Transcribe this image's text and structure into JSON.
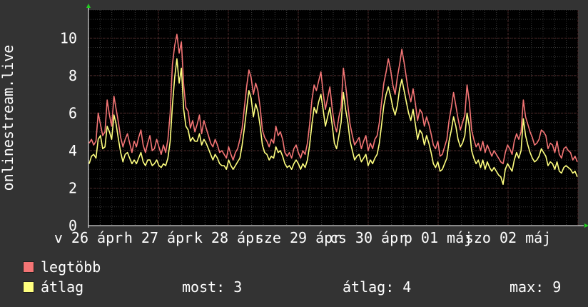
{
  "chart_data": {
    "type": "line",
    "ylabel": "onlinestream.live",
    "ylim": [
      0,
      11.5
    ],
    "yticks": [
      0,
      2,
      4,
      6,
      8,
      10
    ],
    "x_tick_labels": [
      "v 26 ápr",
      "h 27 ápr",
      "k 28 ápr",
      "sze 29 ápr",
      "cs 30 ápr",
      "p 01 máj",
      "szo 02 máj"
    ],
    "grid": true,
    "colors": {
      "background": "#333333",
      "plot_bg": "#000000",
      "legtobb": "#f47575",
      "atlag": "#ffff7f",
      "axis": "#ffffff",
      "grid_major": "#5a2a2a",
      "grid_minor": "#3a3a3a",
      "arrow": "#22cc22"
    },
    "series": [
      {
        "name": "legtöbb",
        "color": "#f47575",
        "values": [
          4.4,
          4.6,
          4.3,
          4.5,
          6.0,
          5.4,
          4.8,
          5.0,
          6.7,
          5.9,
          5.3,
          6.9,
          6.2,
          5.5,
          4.7,
          4.2,
          4.6,
          4.9,
          4.4,
          3.9,
          4.5,
          4.2,
          4.7,
          5.1,
          4.3,
          3.9,
          4.4,
          4.8,
          4.0,
          4.1,
          4.6,
          4.2,
          3.8,
          4.3,
          3.9,
          4.6,
          6.0,
          8.6,
          9.6,
          10.2,
          9.2,
          9.8,
          7.5,
          6.3,
          6.1,
          5.2,
          5.6,
          5.0,
          5.4,
          5.9,
          4.9,
          5.6,
          5.2,
          4.8,
          4.4,
          4.2,
          4.6,
          4.3,
          3.9,
          4.0,
          3.8,
          3.6,
          4.2,
          3.8,
          3.5,
          3.9,
          4.1,
          4.6,
          5.2,
          6.3,
          7.4,
          8.3,
          7.9,
          7.0,
          7.6,
          7.2,
          6.3,
          5.1,
          4.7,
          4.5,
          4.2,
          4.6,
          4.4,
          5.3,
          4.8,
          5.0,
          4.6,
          3.9,
          3.7,
          3.9,
          3.6,
          4.1,
          4.3,
          3.9,
          3.6,
          4.0,
          3.8,
          4.4,
          5.4,
          6.7,
          7.5,
          7.2,
          7.7,
          8.2,
          7.1,
          6.2,
          6.8,
          7.4,
          6.3,
          5.4,
          5.0,
          5.8,
          6.3,
          8.4,
          7.5,
          6.4,
          5.4,
          4.8,
          4.3,
          4.5,
          4.7,
          4.1,
          4.5,
          4.8,
          4.0,
          4.4,
          4.1,
          4.6,
          4.8,
          5.5,
          6.6,
          7.6,
          8.2,
          8.9,
          8.3,
          7.5,
          7.0,
          7.9,
          8.6,
          9.4,
          8.7,
          7.9,
          7.1,
          6.6,
          7.3,
          6.5,
          5.6,
          6.2,
          6.0,
          5.3,
          5.8,
          5.4,
          4.9,
          4.3,
          4.1,
          4.5,
          3.7,
          3.8,
          4.2,
          4.6,
          5.6,
          6.3,
          7.1,
          6.4,
          5.7,
          5.1,
          5.5,
          5.9,
          7.5,
          6.6,
          5.1,
          4.6,
          4.2,
          4.4,
          4.0,
          4.5,
          3.9,
          4.3,
          4.0,
          3.7,
          4.0,
          3.8,
          3.6,
          3.4,
          3.3,
          3.9,
          4.3,
          4.1,
          3.8,
          4.5,
          4.9,
          4.6,
          5.0,
          6.7,
          5.8,
          5.4,
          5.0,
          4.7,
          4.3,
          4.4,
          4.6,
          5.1,
          5.0,
          4.8,
          4.1,
          4.4,
          4.3,
          3.9,
          4.5,
          3.8,
          3.6,
          4.1,
          4.2,
          4.0,
          3.9,
          3.5,
          3.7,
          3.4
        ]
      },
      {
        "name": "átlag",
        "color": "#ffff7f",
        "values": [
          3.3,
          3.7,
          3.8,
          3.6,
          4.6,
          4.8,
          4.1,
          4.2,
          5.3,
          5.0,
          4.6,
          5.9,
          5.4,
          4.6,
          3.9,
          3.4,
          3.8,
          3.9,
          3.6,
          3.3,
          3.5,
          3.3,
          3.6,
          3.9,
          3.4,
          3.2,
          3.5,
          3.5,
          3.2,
          3.3,
          3.5,
          3.2,
          3.1,
          3.3,
          3.2,
          3.6,
          4.5,
          6.4,
          7.9,
          8.9,
          7.6,
          8.4,
          6.2,
          5.3,
          5.1,
          4.5,
          4.7,
          4.5,
          4.5,
          4.9,
          4.3,
          4.6,
          4.4,
          4.1,
          3.8,
          3.5,
          3.8,
          3.6,
          3.3,
          3.2,
          3.2,
          3.0,
          3.5,
          3.2,
          3.0,
          3.2,
          3.4,
          3.6,
          4.3,
          5.2,
          6.2,
          7.2,
          6.8,
          5.8,
          6.5,
          6.1,
          5.3,
          4.3,
          3.9,
          3.8,
          3.5,
          3.7,
          3.6,
          4.2,
          3.9,
          4.0,
          3.7,
          3.3,
          3.1,
          3.2,
          3.0,
          3.3,
          3.5,
          3.3,
          3.0,
          3.3,
          3.1,
          3.5,
          4.3,
          5.4,
          6.3,
          6.0,
          6.6,
          7.0,
          6.2,
          5.3,
          5.8,
          6.3,
          5.4,
          4.4,
          4.1,
          4.8,
          5.5,
          7.1,
          6.2,
          5.5,
          4.5,
          4.0,
          3.5,
          3.7,
          3.8,
          3.4,
          3.6,
          3.8,
          3.2,
          3.5,
          3.3,
          3.6,
          3.8,
          4.4,
          5.4,
          6.4,
          7.0,
          7.4,
          6.9,
          6.3,
          5.9,
          6.4,
          7.3,
          7.8,
          7.2,
          6.6,
          6.0,
          5.6,
          6.2,
          5.4,
          4.6,
          5.1,
          4.9,
          4.3,
          4.8,
          4.4,
          3.9,
          3.3,
          3.1,
          3.4,
          2.9,
          3.0,
          3.3,
          3.6,
          4.5,
          5.1,
          5.8,
          5.3,
          4.6,
          4.2,
          4.4,
          4.8,
          6.0,
          5.3,
          4.0,
          3.6,
          3.3,
          3.5,
          3.1,
          3.5,
          3.0,
          3.4,
          3.1,
          2.9,
          3.1,
          2.9,
          2.7,
          2.6,
          2.2,
          3.0,
          3.3,
          3.1,
          2.9,
          3.5,
          3.9,
          3.6,
          4.0,
          5.7,
          4.8,
          4.3,
          3.9,
          3.6,
          3.4,
          3.5,
          3.7,
          4.1,
          3.9,
          3.7,
          3.2,
          3.4,
          3.3,
          3.0,
          3.4,
          2.9,
          2.8,
          3.1,
          3.2,
          3.1,
          3.0,
          2.8,
          2.9,
          2.6
        ]
      }
    ]
  },
  "legend": {
    "items": [
      {
        "label": "legtöbb",
        "color": "#f47575"
      },
      {
        "label": "átlag",
        "color": "#ffff7f"
      }
    ],
    "stats": {
      "most": "most: 3",
      "atlag": "átlag: 4",
      "max": "max: 9"
    }
  }
}
